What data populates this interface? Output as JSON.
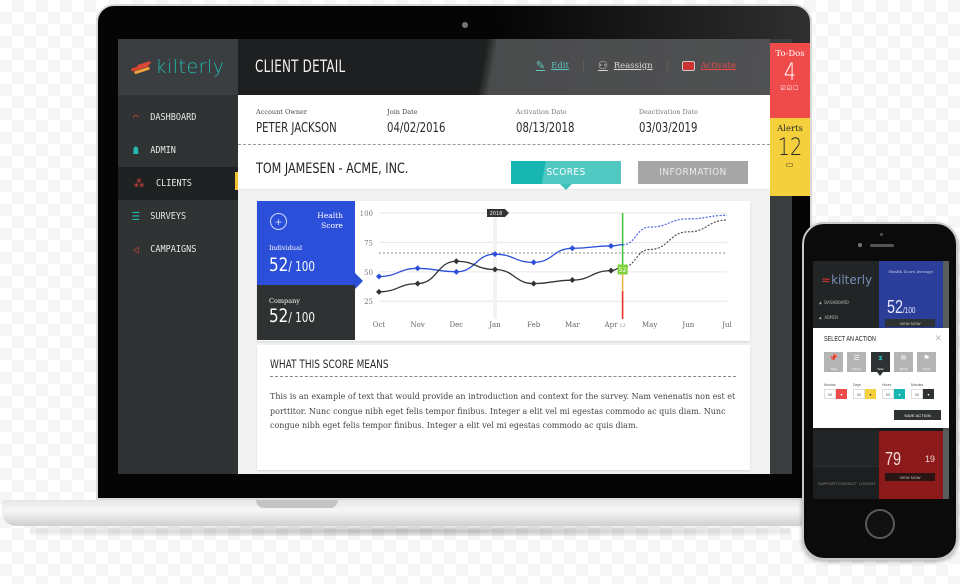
{
  "app": {
    "brand": "kilterly",
    "page_title": "CLIENT DETAIL"
  },
  "sidebar": {
    "items": [
      {
        "label": "DASHBOARD",
        "icon": "gauge-icon",
        "color": "#d9463c",
        "active": false
      },
      {
        "label": "ADMIN",
        "icon": "org-chart-icon",
        "color": "#25b8b0",
        "active": false
      },
      {
        "label": "CLIENTS",
        "icon": "people-icon",
        "color": "#d9463c",
        "active": true
      },
      {
        "label": "SURVEYS",
        "icon": "list-icon",
        "color": "#25b8b0",
        "active": false
      },
      {
        "label": "CAMPAIGNS",
        "icon": "megaphone-icon",
        "color": "#d9463c",
        "active": false
      }
    ]
  },
  "toolbar": {
    "edit_label": "Edit",
    "reassign_label": "Reassign",
    "activate_label": "Activate"
  },
  "rail": {
    "todos_label": "To-Dos",
    "todos_count": "4",
    "alerts_label": "Alerts",
    "alerts_count": "12"
  },
  "account": {
    "owner_label": "Account Owner",
    "owner_value": "PETER JACKSON",
    "join_label": "Join Date",
    "join_value": "04/02/2016",
    "activation_label": "Activation Date",
    "activation_value": "08/13/2018",
    "deactivation_label": "Deactivation Date",
    "deactivation_value": "03/03/2019"
  },
  "client": {
    "name": "TOM JAMESEN  -  ACME, INC.",
    "tabs": [
      {
        "label": "SCORES",
        "active": true
      },
      {
        "label": "INFORMATION",
        "active": false
      }
    ]
  },
  "health": {
    "title_line1": "Health",
    "title_line2": "Score",
    "individual_label": "Individual",
    "individual_score": "52",
    "individual_max": "/ 100",
    "company_label": "Company",
    "company_score": "52",
    "company_max": "/ 100"
  },
  "chart_data": {
    "type": "line",
    "title": "",
    "xlabel": "",
    "ylabel": "",
    "ylim": [
      15,
      100
    ],
    "yticks": [
      25,
      50,
      75,
      100
    ],
    "categories": [
      "Oct",
      "Nov",
      "Dec",
      "Jan",
      "Feb",
      "Mar",
      "Apr",
      "May",
      "Jun",
      "Jul"
    ],
    "year_marker": {
      "label": "2018",
      "at": "Jan"
    },
    "today_marker": {
      "label": "12",
      "position": 6.3,
      "value": 52
    },
    "benchmark": 66,
    "series": [
      {
        "name": "Individual",
        "color": "#2b4fd9",
        "x": [
          0,
          1,
          2,
          3,
          4,
          5,
          6,
          6.3
        ],
        "values": [
          46,
          53,
          50,
          65,
          58,
          70,
          72,
          73
        ],
        "projection_x": [
          6.3,
          7,
          8,
          9
        ],
        "projection_values": [
          73,
          88,
          95,
          98
        ]
      },
      {
        "name": "Company",
        "color": "#333333",
        "x": [
          0,
          1,
          2,
          3,
          4,
          5,
          6,
          6.3
        ],
        "values": [
          33,
          40,
          59,
          52,
          40,
          43,
          51,
          54
        ],
        "projection_x": [
          6.3,
          7,
          8,
          9
        ],
        "projection_values": [
          54,
          69,
          84,
          94
        ]
      }
    ]
  },
  "meaning": {
    "title": "WHAT THIS SCORE MEANS",
    "body": "This is an example of text that would provide an introduction and context for the survey. Nam venenatis non est et porttitor. Nunc congue nibh eget felis tempor finibus. Integer a elit vel mi egestas commodo ac quis diam. Nunc congue nibh eget felis tempor finibus. Integer a elit vel mi egestas commodo ac quis diam."
  },
  "phone": {
    "brand": "kilterly",
    "nav": [
      "DASHBOARD",
      "ADMIN"
    ],
    "health_label": "Health Score Average",
    "score": "52",
    "score_max": "/100",
    "view_now": "VIEW NOW",
    "red_score": "79",
    "red_small": "19",
    "bottom_nav": [
      "SUPPORT",
      "CONTACT",
      "LOGOUT"
    ],
    "modal": {
      "title": "SELECT AN ACTION",
      "actions": [
        {
          "label": "Task",
          "glyph": "📌",
          "selected": false
        },
        {
          "label": "Survey",
          "glyph": "☰",
          "selected": false
        },
        {
          "label": "Wait",
          "glyph": "⧗",
          "selected": true
        },
        {
          "label": "Email",
          "glyph": "✉",
          "selected": false
        },
        {
          "label": "Finish",
          "glyph": "⚑",
          "selected": false
        }
      ],
      "fields": [
        {
          "label": "Months",
          "value": "00",
          "color": "#f04b4b"
        },
        {
          "label": "Days",
          "value": "00",
          "color": "#f4d03c"
        },
        {
          "label": "Hours",
          "value": "00",
          "color": "#17b6b0"
        },
        {
          "label": "Minutes",
          "value": "00",
          "color": "#2e3233"
        }
      ],
      "save_label": "SAVE ACTION"
    }
  }
}
